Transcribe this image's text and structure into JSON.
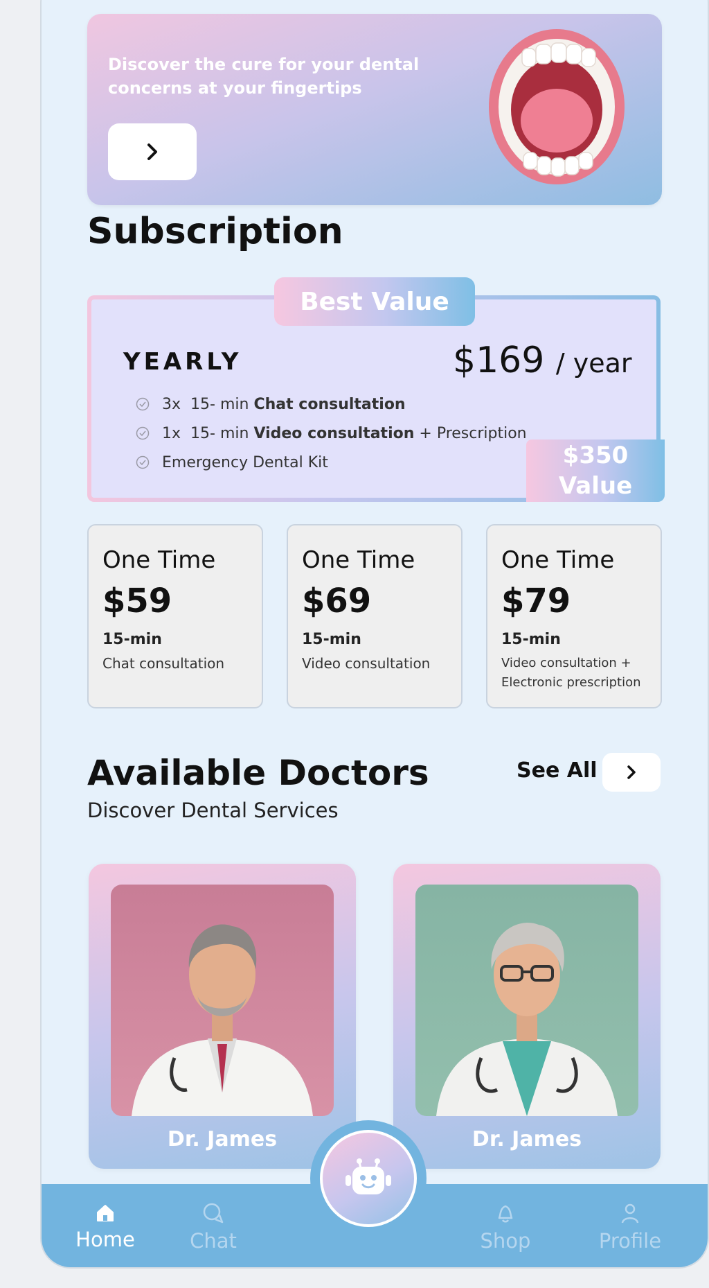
{
  "banner": {
    "text": "Discover the cure for your dental concerns at your fingertips",
    "button_icon": "chevron-right-icon"
  },
  "subscription": {
    "title": "Subscription",
    "badge": "Best Value",
    "plan_name": "YEARLY",
    "price": "$169",
    "period": "/ year",
    "features": [
      {
        "count": "3x",
        "pre": "15- min",
        "bold": "Chat consultation",
        "post": ""
      },
      {
        "count": "1x",
        "pre": "15- min",
        "bold": "Video consultation",
        "post": "+ Prescription"
      },
      {
        "count": "",
        "pre": "",
        "bold": "",
        "post": "Emergency Dental Kit"
      }
    ],
    "value_amount": "$350",
    "value_label": "Value"
  },
  "one_time_plans": [
    {
      "type": "One Time",
      "price": "$59",
      "duration": "15-min",
      "description": "Chat  consultation"
    },
    {
      "type": "One Time",
      "price": "$69",
      "duration": "15-min",
      "description": "Video  consultation"
    },
    {
      "type": "One Time",
      "price": "$79",
      "duration": "15-min",
      "description": "Video consultation + Electronic prescription"
    }
  ],
  "doctors": {
    "title": "Available Doctors",
    "subtitle": "Discover Dental Services",
    "see_all": "See All",
    "list": [
      {
        "name": "Dr. James",
        "photo_bg": "#c97f98"
      },
      {
        "name": "Dr. James",
        "photo_bg": "#7fae9f"
      }
    ]
  },
  "nav": {
    "items": [
      {
        "label": "Home",
        "icon": "home-icon",
        "active": true
      },
      {
        "label": "Chat",
        "icon": "chat-icon",
        "active": false
      },
      {
        "label": "Shop",
        "icon": "bell-icon",
        "active": false
      },
      {
        "label": "Profile",
        "icon": "profile-icon",
        "active": false
      }
    ],
    "center_icon": "bot-icon"
  },
  "colors": {
    "accent_blue": "#72b4df",
    "accent_pink": "#f4c7df",
    "background": "#e6f1fb"
  }
}
